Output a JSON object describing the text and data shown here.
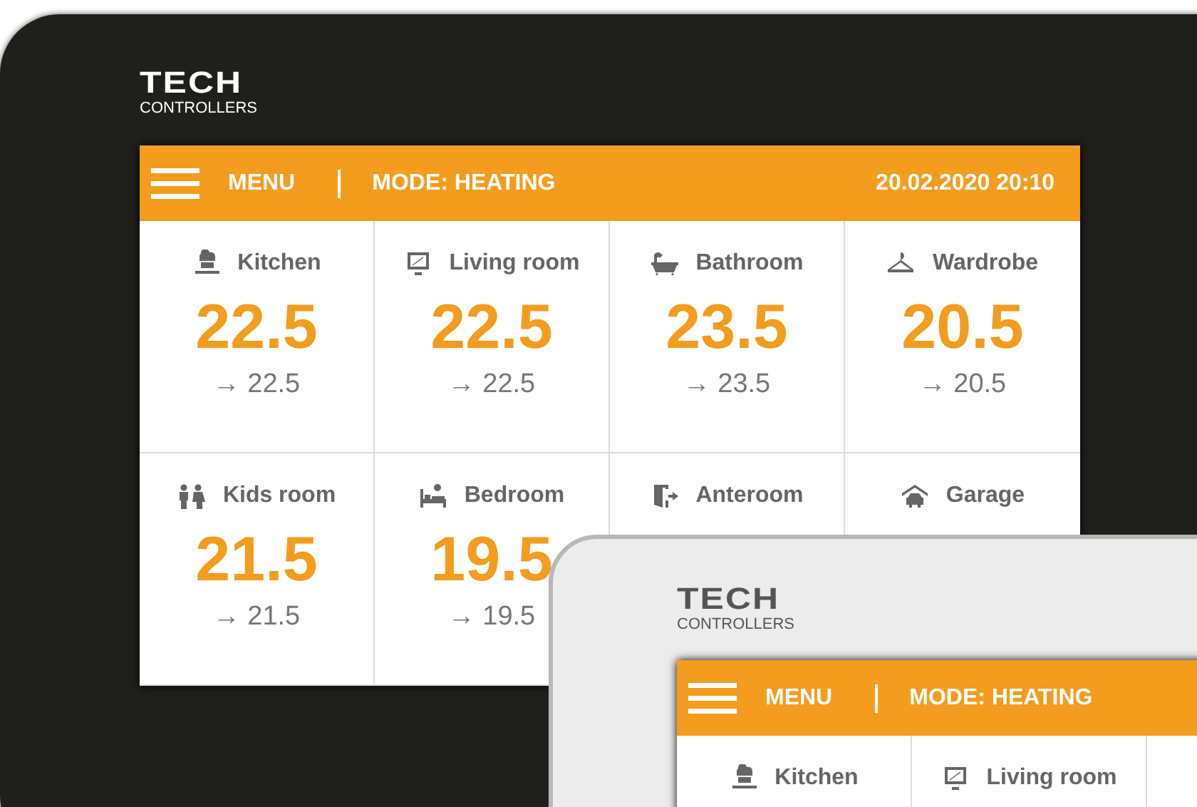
{
  "main_device": {
    "logo": {
      "brand": "TECH",
      "subtitle": "CONTROLLERS"
    },
    "header": {
      "menu": "MENU",
      "mode": "MODE: HEATING",
      "datetime": "20.02.2020 20:10"
    },
    "rooms": [
      {
        "kind": "kitchen",
        "name": "Kitchen",
        "temperature": "22.5",
        "target": "→ 22.5"
      },
      {
        "kind": "tv",
        "name": "Living room",
        "temperature": "22.5",
        "target": "→ 22.5"
      },
      {
        "kind": "bath",
        "name": "Bathroom",
        "temperature": "23.5",
        "target": "→ 23.5"
      },
      {
        "kind": "hanger",
        "name": "Wardrobe",
        "temperature": "20.5",
        "target": "→ 20.5"
      },
      {
        "kind": "kids",
        "name": "Kids room",
        "temperature": "21.5",
        "target": "→ 21.5"
      },
      {
        "kind": "bed",
        "name": "Bedroom",
        "temperature": "19.5",
        "target": "→ 19.5"
      },
      {
        "kind": "door",
        "name": "Anteroom"
      },
      {
        "kind": "garage",
        "name": "Garage"
      }
    ]
  },
  "second_device": {
    "logo": {
      "brand": "TECH",
      "subtitle": "CONTROLLERS"
    },
    "header": {
      "menu": "MENU",
      "mode": "MODE: HEATING"
    },
    "rooms": [
      {
        "kind": "kitchen",
        "name": "Kitchen"
      },
      {
        "kind": "tv",
        "name": "Living room"
      }
    ]
  }
}
